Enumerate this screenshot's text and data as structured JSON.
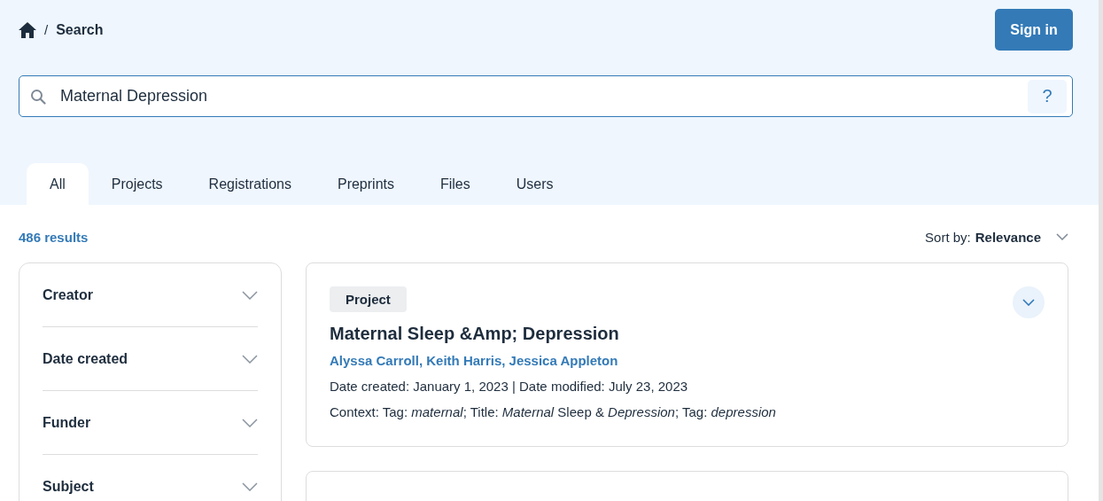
{
  "breadcrumb": {
    "separator": "/",
    "current": "Search"
  },
  "sign_in_button": "Sign in",
  "search": {
    "value": "Maternal Depression",
    "help": "?"
  },
  "tabs": [
    {
      "label": "All",
      "selected": true
    },
    {
      "label": "Projects",
      "selected": false
    },
    {
      "label": "Registrations",
      "selected": false
    },
    {
      "label": "Preprints",
      "selected": false
    },
    {
      "label": "Files",
      "selected": false
    },
    {
      "label": "Users",
      "selected": false
    }
  ],
  "results_count": "486 results",
  "sort": {
    "label": "Sort by:",
    "value": "Relevance"
  },
  "filters": [
    {
      "label": "Creator",
      "expanded": false
    },
    {
      "label": "Date created",
      "expanded": false
    },
    {
      "label": "Funder",
      "expanded": false
    },
    {
      "label": "Subject",
      "expanded": false
    }
  ],
  "results": [
    {
      "type": "Project",
      "title": "Maternal Sleep &Amp; Depression",
      "authors": "Alyssa Carroll, Keith Harris, Jessica Appleton",
      "dates": "Date created: January 1, 2023 | Date modified: July 23, 2023",
      "context": "Context: Tag: *maternal*; Title: *Maternal* Sleep & *Depression*; Tag: *depression*",
      "expanded": false
    }
  ]
}
